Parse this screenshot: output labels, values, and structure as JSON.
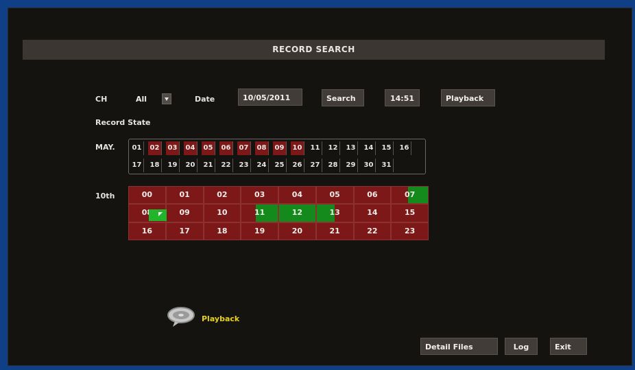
{
  "title": "RECORD SEARCH",
  "controls": {
    "ch_label": "CH",
    "ch_value": "All",
    "date_label": "Date",
    "date_value": "10/05/2011",
    "search_button": "Search",
    "time_value": "14:51",
    "playback_button": "Playback"
  },
  "record_state_label": "Record State",
  "calendar": {
    "month_label": "MAY.",
    "days": [
      "01",
      "02",
      "03",
      "04",
      "05",
      "06",
      "07",
      "08",
      "09",
      "10",
      "11",
      "12",
      "13",
      "14",
      "15",
      "16",
      "17",
      "18",
      "19",
      "20",
      "21",
      "22",
      "23",
      "24",
      "25",
      "26",
      "27",
      "28",
      "29",
      "30",
      "31"
    ],
    "recorded_days": [
      "02",
      "03",
      "04",
      "05",
      "06",
      "07",
      "08",
      "09",
      "10"
    ]
  },
  "day_grid": {
    "day_label": "10th",
    "hours": [
      "00",
      "01",
      "02",
      "03",
      "04",
      "05",
      "06",
      "07",
      "08",
      "09",
      "10",
      "11",
      "12",
      "13",
      "14",
      "15",
      "16",
      "17",
      "18",
      "19",
      "20",
      "21",
      "22",
      "23"
    ]
  },
  "playback_label": "Playback",
  "bottom_buttons": {
    "detail_files": "Detail Files",
    "log": "Log",
    "exit": "Exit"
  },
  "colors": {
    "recorded": "#7d1818",
    "motion": "#138a1b",
    "accent_text": "#e6d21c"
  }
}
